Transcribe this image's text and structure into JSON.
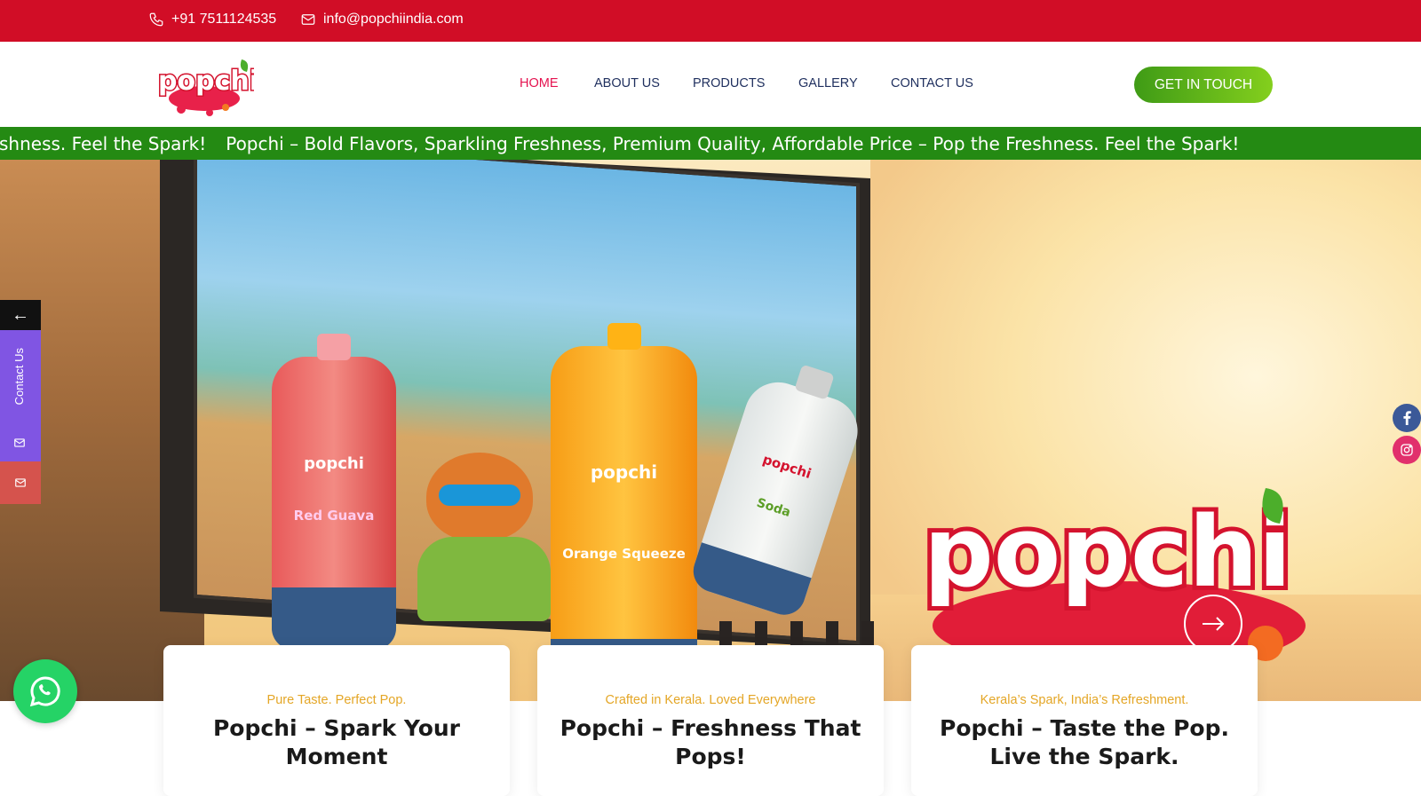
{
  "topbar": {
    "phone": "+91 7511124535",
    "email": "info@popchiindia.com",
    "background": "#d10d26"
  },
  "header": {
    "logo_text": "popchi",
    "nav": [
      {
        "label": "HOME",
        "active": true
      },
      {
        "label": "ABOUT US",
        "active": false
      },
      {
        "label": "PRODUCTS",
        "active": false
      },
      {
        "label": "GALLERY",
        "active": false
      },
      {
        "label": "CONTACT US",
        "active": false
      }
    ],
    "cta_label": "GET IN TOUCH"
  },
  "ticker": {
    "prefix": "shness. Feel the Spark!",
    "text": "Popchi – Bold Flavors, Sparkling Freshness, Premium Quality, Affordable Price – Pop the Freshness. Feel the Spark!",
    "background": "#248a13"
  },
  "hero": {
    "bottles": [
      {
        "flavor": "Red Guava",
        "brand": "popchi"
      },
      {
        "flavor": "Orange Squeeze",
        "brand": "popchi"
      },
      {
        "flavor": "Soda",
        "brand": "popchi"
      }
    ],
    "brand_logo": "popchi",
    "next_icon": "arrow-right-icon"
  },
  "side_widget": {
    "back_icon": "arrow-left-icon",
    "contact_label": "Contact Us",
    "mail_icon": "envelope-icon"
  },
  "social": [
    {
      "icon": "facebook-icon",
      "color": "#3b5998"
    },
    {
      "icon": "instagram-icon",
      "color": "#e1306c"
    }
  ],
  "cards": [
    {
      "tag": "Pure Taste. Perfect Pop.",
      "title": "Popchi – Spark Your Moment"
    },
    {
      "tag": "Crafted in Kerala. Loved Everywhere",
      "title": "Popchi – Freshness That Pops!"
    },
    {
      "tag": "Kerala’s Spark, India’s Refreshment.",
      "title": "Popchi – Taste the Pop. Live the Spark."
    }
  ],
  "whatsapp_icon": "whatsapp-icon",
  "colors": {
    "accent_red": "#d10d26",
    "accent_green": "#248a13",
    "nav_active": "#e4124f",
    "card_tag": "#e4a626"
  }
}
